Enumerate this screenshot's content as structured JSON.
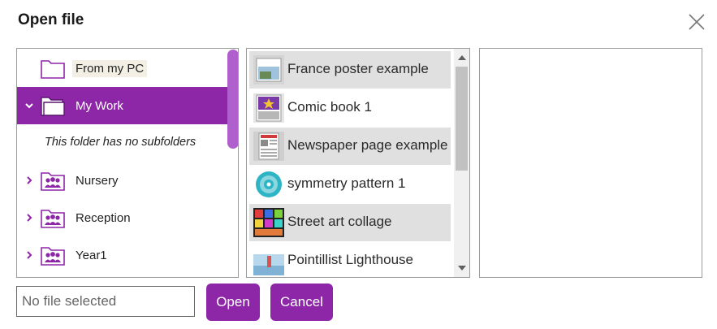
{
  "dialog": {
    "title": "Open file"
  },
  "folders": {
    "from_pc": "From my PC",
    "my_work": "My Work",
    "no_subfolders": "This folder has no subfolders",
    "groups": [
      {
        "label": "Nursery"
      },
      {
        "label": "Reception"
      },
      {
        "label": "Year1"
      }
    ]
  },
  "files": [
    {
      "name": "France poster example"
    },
    {
      "name": "Comic book 1"
    },
    {
      "name": "Newspaper page example"
    },
    {
      "name": "symmetry pattern 1"
    },
    {
      "name": "Street art collage"
    },
    {
      "name": "Pointillist Lighthouse"
    }
  ],
  "footer": {
    "file_placeholder": "No file selected",
    "open_label": "Open",
    "cancel_label": "Cancel"
  },
  "colors": {
    "accent": "#8e26a8",
    "selection_gray": "#e0e0e0"
  }
}
